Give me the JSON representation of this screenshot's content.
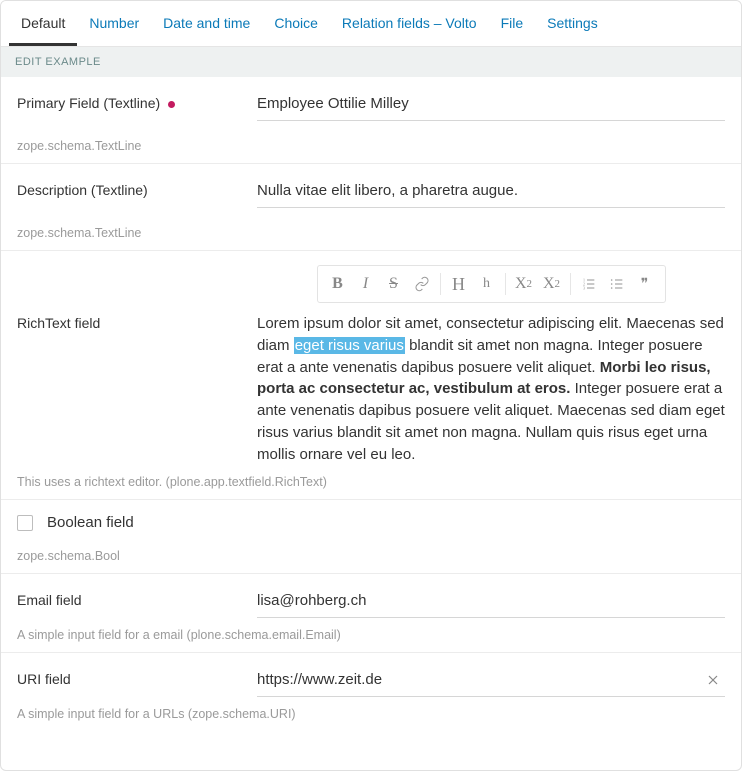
{
  "tabs": {
    "items": [
      {
        "label": "Default",
        "active": true
      },
      {
        "label": "Number",
        "active": false
      },
      {
        "label": "Date and time",
        "active": false
      },
      {
        "label": "Choice",
        "active": false
      },
      {
        "label": "Relation fields – Volto",
        "active": false
      },
      {
        "label": "File",
        "active": false
      },
      {
        "label": "Settings",
        "active": false
      }
    ]
  },
  "section_header": "EDIT EXAMPLE",
  "fields": {
    "primary": {
      "label": "Primary Field (Textline)",
      "required": true,
      "value": "Employee Ottilie Milley",
      "help": "zope.schema.TextLine"
    },
    "description": {
      "label": "Description (Textline)",
      "value": "Nulla vitae elit libero, a pharetra augue.",
      "help": "zope.schema.TextLine"
    },
    "richtext": {
      "label": "RichText field",
      "text_pre": "Lorem ipsum dolor sit amet, consectetur adipiscing elit. Maecenas sed diam ",
      "text_highlight": "eget risus varius",
      "text_mid": " blandit sit amet non magna. Integer posuere erat a ante venenatis dapibus posuere velit aliquet. ",
      "text_bold": "Morbi leo risus, porta ac consectetur ac, vestibulum at eros.",
      "text_post": " Integer posuere erat a ante venenatis dapibus posuere velit aliquet. Maecenas sed diam eget risus varius blandit sit amet non magna. Nullam quis risus eget urna mollis ornare vel eu leo.",
      "help": "This uses a richtext editor. (plone.app.textfield.RichText)"
    },
    "boolean": {
      "label": "Boolean field",
      "checked": false,
      "help": "zope.schema.Bool"
    },
    "email": {
      "label": "Email field",
      "value": "lisa@rohberg.ch",
      "help": "A simple input field for a email (plone.schema.email.Email)"
    },
    "uri": {
      "label": "URI field",
      "value": "https://www.zeit.de",
      "help": "A simple input field for a URLs (zope.schema.URI)"
    }
  },
  "toolbar": {
    "bold": "B",
    "italic": "I",
    "strike": "S",
    "headH": "H",
    "headh": "h",
    "subX": "X",
    "sub2": "2",
    "supX": "X",
    "sup2": "2",
    "quote": "❞"
  }
}
